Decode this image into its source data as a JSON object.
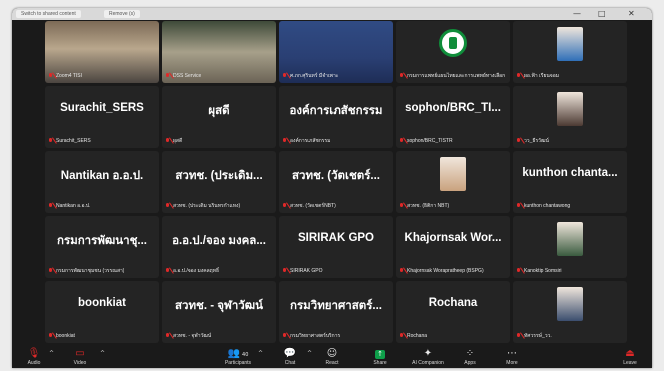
{
  "window": {
    "tabs": [
      "Switch to shared content",
      "Remove (s)"
    ],
    "controls": [
      "—",
      "□",
      "✕"
    ]
  },
  "tiles": [
    {
      "type": "video",
      "style": "video-bg-1",
      "name": "Zoom4 TISI"
    },
    {
      "type": "video",
      "style": "video-bg-2",
      "name": "DSS Service"
    },
    {
      "type": "video",
      "style": "video-bg-3",
      "name": "ศ.ภก.ศุรินทร์ มีจำเพาะ"
    },
    {
      "type": "logo",
      "name": "กรมการแพทย์แผนไทยและการแพทย์ทางเลือก"
    },
    {
      "type": "avatar",
      "name": "ผอ.ฟ้า เรียนจอม",
      "avatar_color": "#2f6fb8"
    },
    {
      "type": "text",
      "center": "Surachit_SERS",
      "name": "Surachit_SERS"
    },
    {
      "type": "text",
      "center": "ผุสดี",
      "name": "ผุสดี"
    },
    {
      "type": "text",
      "center": "องค์การเภสัชกรรม",
      "name": "องค์การเภสัชกรรม"
    },
    {
      "type": "text",
      "center": "sophon/BRC_TI...",
      "name": "sophon/BRC_TISTR"
    },
    {
      "type": "avatar",
      "name": "วว_ธีรวัฒน์",
      "avatar_color": "#4c3a33"
    },
    {
      "type": "text",
      "center": "Nantikan อ.อ.ป.",
      "name": "Nantikan อ.อ.ป."
    },
    {
      "type": "text",
      "center": "สวทช. (ประเดิม...",
      "name": "สวทช. (ประเดิม นรินทรกำแหง)"
    },
    {
      "type": "text",
      "center": "สวทช. (วัตเชตร์...",
      "name": "สวทช. (วัดเชตร์NBT)"
    },
    {
      "type": "avatar",
      "name": "สวทช. (ธิติกา NBT)",
      "avatar_color": "#c9a27e"
    },
    {
      "type": "text",
      "center": "kunthon chanta...",
      "name": "kunthon chantawong"
    },
    {
      "type": "text",
      "center": "กรมการพัฒนาชุ...",
      "name": "กรมการพัฒนาชุมชน (วรรณสา)"
    },
    {
      "type": "text",
      "center": "อ.อ.ป./จอง มงคล...",
      "name": "อ.อ.ป./จอง มงคลฤทธิ์"
    },
    {
      "type": "text",
      "center": "SIRIRAK GPO",
      "name": "SIRIRAK GPO"
    },
    {
      "type": "text",
      "center": "Khajornsak Wor...",
      "name": "Khajornsak Worapratheep (BSPG)"
    },
    {
      "type": "avatar",
      "name": "Kanoktip Somsiri",
      "avatar_color": "#3a5b3f"
    },
    {
      "type": "text",
      "center": "boonkiat",
      "name": "boonkiat"
    },
    {
      "type": "text",
      "center": "สวทช. - จุฬาวัฒน์",
      "name": "สวทช. - จุฬาวัฒน์"
    },
    {
      "type": "text",
      "center": "กรมวิทยาศาสตร์...",
      "name": "กรมวิทยาศาสตร์บริการ"
    },
    {
      "type": "text",
      "center": "Rochana",
      "name": "Rochana"
    },
    {
      "type": "avatar",
      "name": "ทัศวรรษ์_วว.",
      "avatar_color": "#3b4e6e"
    }
  ],
  "toolbar": {
    "audio": "Audio",
    "video": "Video",
    "participants": "Participants",
    "participants_count": "40",
    "chat": "Chat",
    "react": "React",
    "share": "Share",
    "ai": "AI Companion",
    "apps": "Apps",
    "more": "More",
    "leave": "Leave"
  },
  "colors": {
    "mic_muted": "#e02828",
    "share_green": "#0e9f4a",
    "tile_bg": "#242424"
  }
}
